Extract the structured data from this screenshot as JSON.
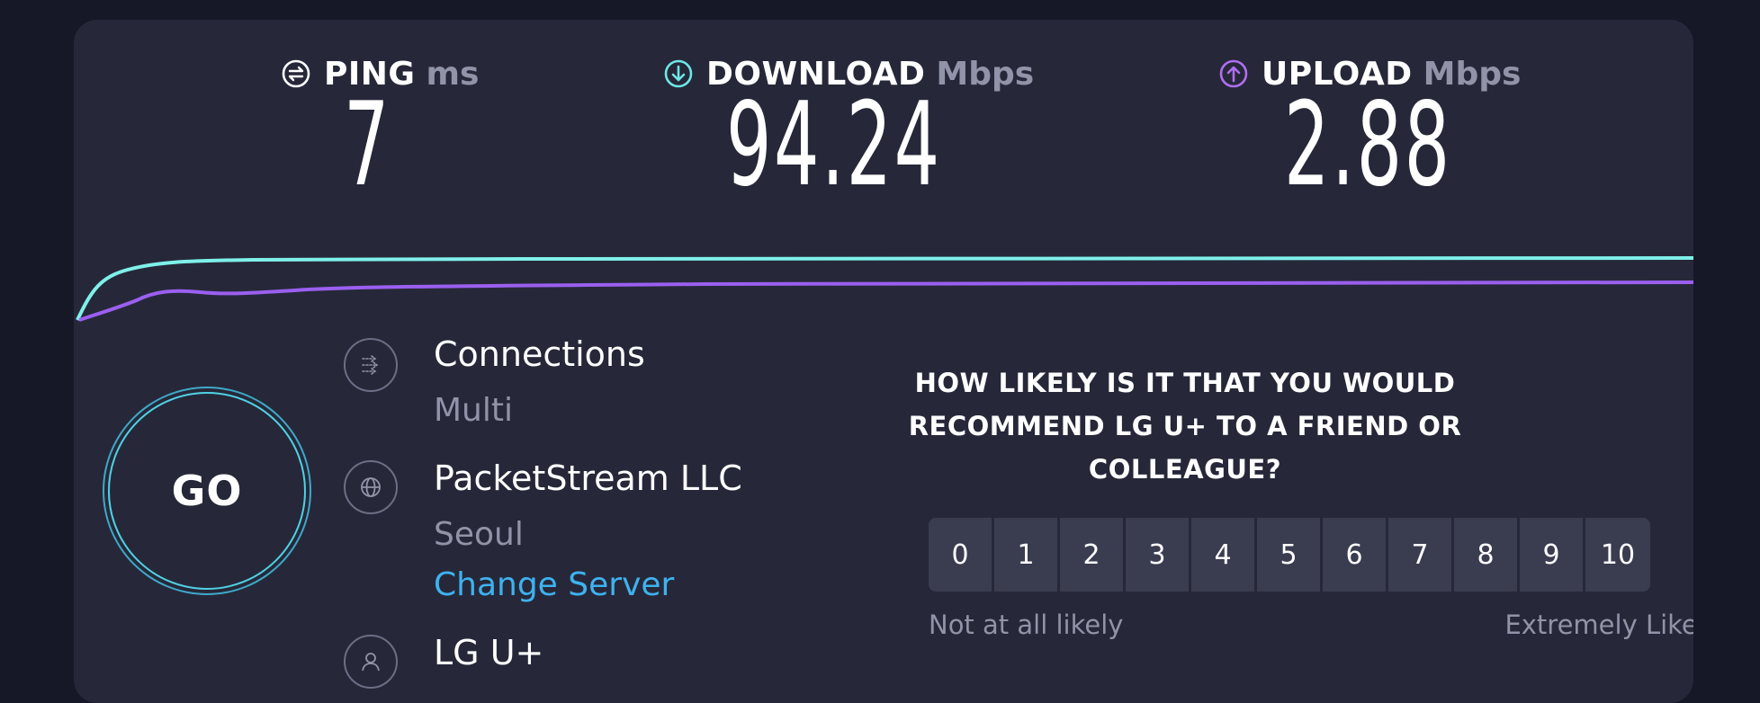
{
  "metrics": {
    "ping": {
      "label": "PING",
      "unit": "ms",
      "value": "7",
      "icon": "ping-icon",
      "color": "#ffffff"
    },
    "download": {
      "label": "DOWNLOAD",
      "unit": "Mbps",
      "value": "94.24",
      "icon": "download-arrow-icon",
      "color": "#6ee6e6"
    },
    "upload": {
      "label": "UPLOAD",
      "unit": "Mbps",
      "value": "2.88",
      "icon": "upload-arrow-icon",
      "color": "#b06ef0"
    }
  },
  "graph": {
    "download_color": "#7ff0ea",
    "upload_color": "#9b5ff0"
  },
  "go_button": {
    "label": "GO"
  },
  "connection": {
    "connections": {
      "title": "Connections",
      "value": "Multi",
      "icon": "connections-icon"
    },
    "server": {
      "title": "PacketStream LLC",
      "location": "Seoul",
      "change_label": "Change Server",
      "icon": "globe-icon"
    },
    "provider": {
      "title": "LG U+",
      "icon": "user-icon"
    }
  },
  "survey": {
    "question": "HOW LIKELY IS IT THAT YOU WOULD RECOMMEND LG U+ TO A FRIEND OR COLLEAGUE?",
    "options": [
      "0",
      "1",
      "2",
      "3",
      "4",
      "5",
      "6",
      "7",
      "8",
      "9",
      "10"
    ],
    "low_label": "Not at all likely",
    "high_label": "Extremely Likely"
  },
  "colors": {
    "background": "#161727",
    "panel": "#262839",
    "accent_link": "#3fb2ef",
    "muted_text": "#9193a8"
  }
}
